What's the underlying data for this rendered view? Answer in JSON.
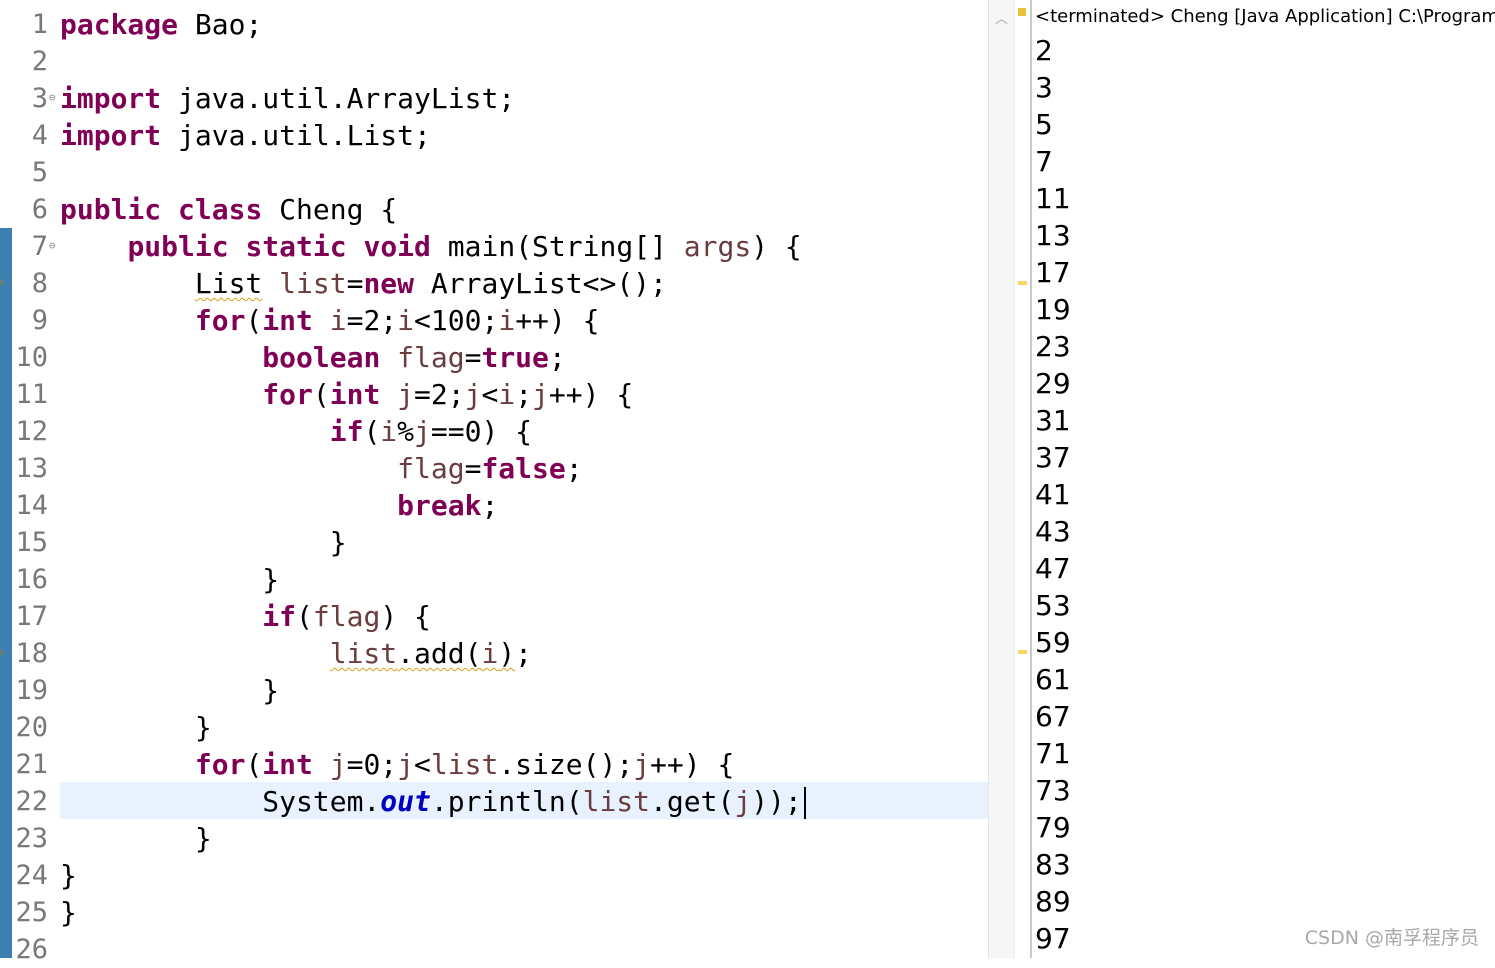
{
  "editor": {
    "line_numbers": [
      "1",
      "2",
      "3",
      "4",
      "5",
      "6",
      "7",
      "8",
      "9",
      "10",
      "11",
      "12",
      "13",
      "14",
      "15",
      "16",
      "17",
      "18",
      "19",
      "20",
      "21",
      "22",
      "23",
      "24",
      "25",
      "26"
    ],
    "fold_icon": "collapse-icon",
    "warning_icon": "warning-icon"
  },
  "console": {
    "header": "<terminated> Cheng [Java Application] C:\\Program Fi",
    "output": [
      "2",
      "3",
      "5",
      "7",
      "11",
      "13",
      "17",
      "19",
      "23",
      "29",
      "31",
      "37",
      "41",
      "43",
      "47",
      "53",
      "59",
      "61",
      "67",
      "71",
      "73",
      "79",
      "83",
      "89",
      "97"
    ]
  },
  "watermark": "CSDN @南孚程序员",
  "colors": {
    "keyword": "#7f0055",
    "field": "#0000c0",
    "variable": "#6a3e3e",
    "current_line": "#e8f2fe",
    "ruler": "#3c7fb1"
  }
}
